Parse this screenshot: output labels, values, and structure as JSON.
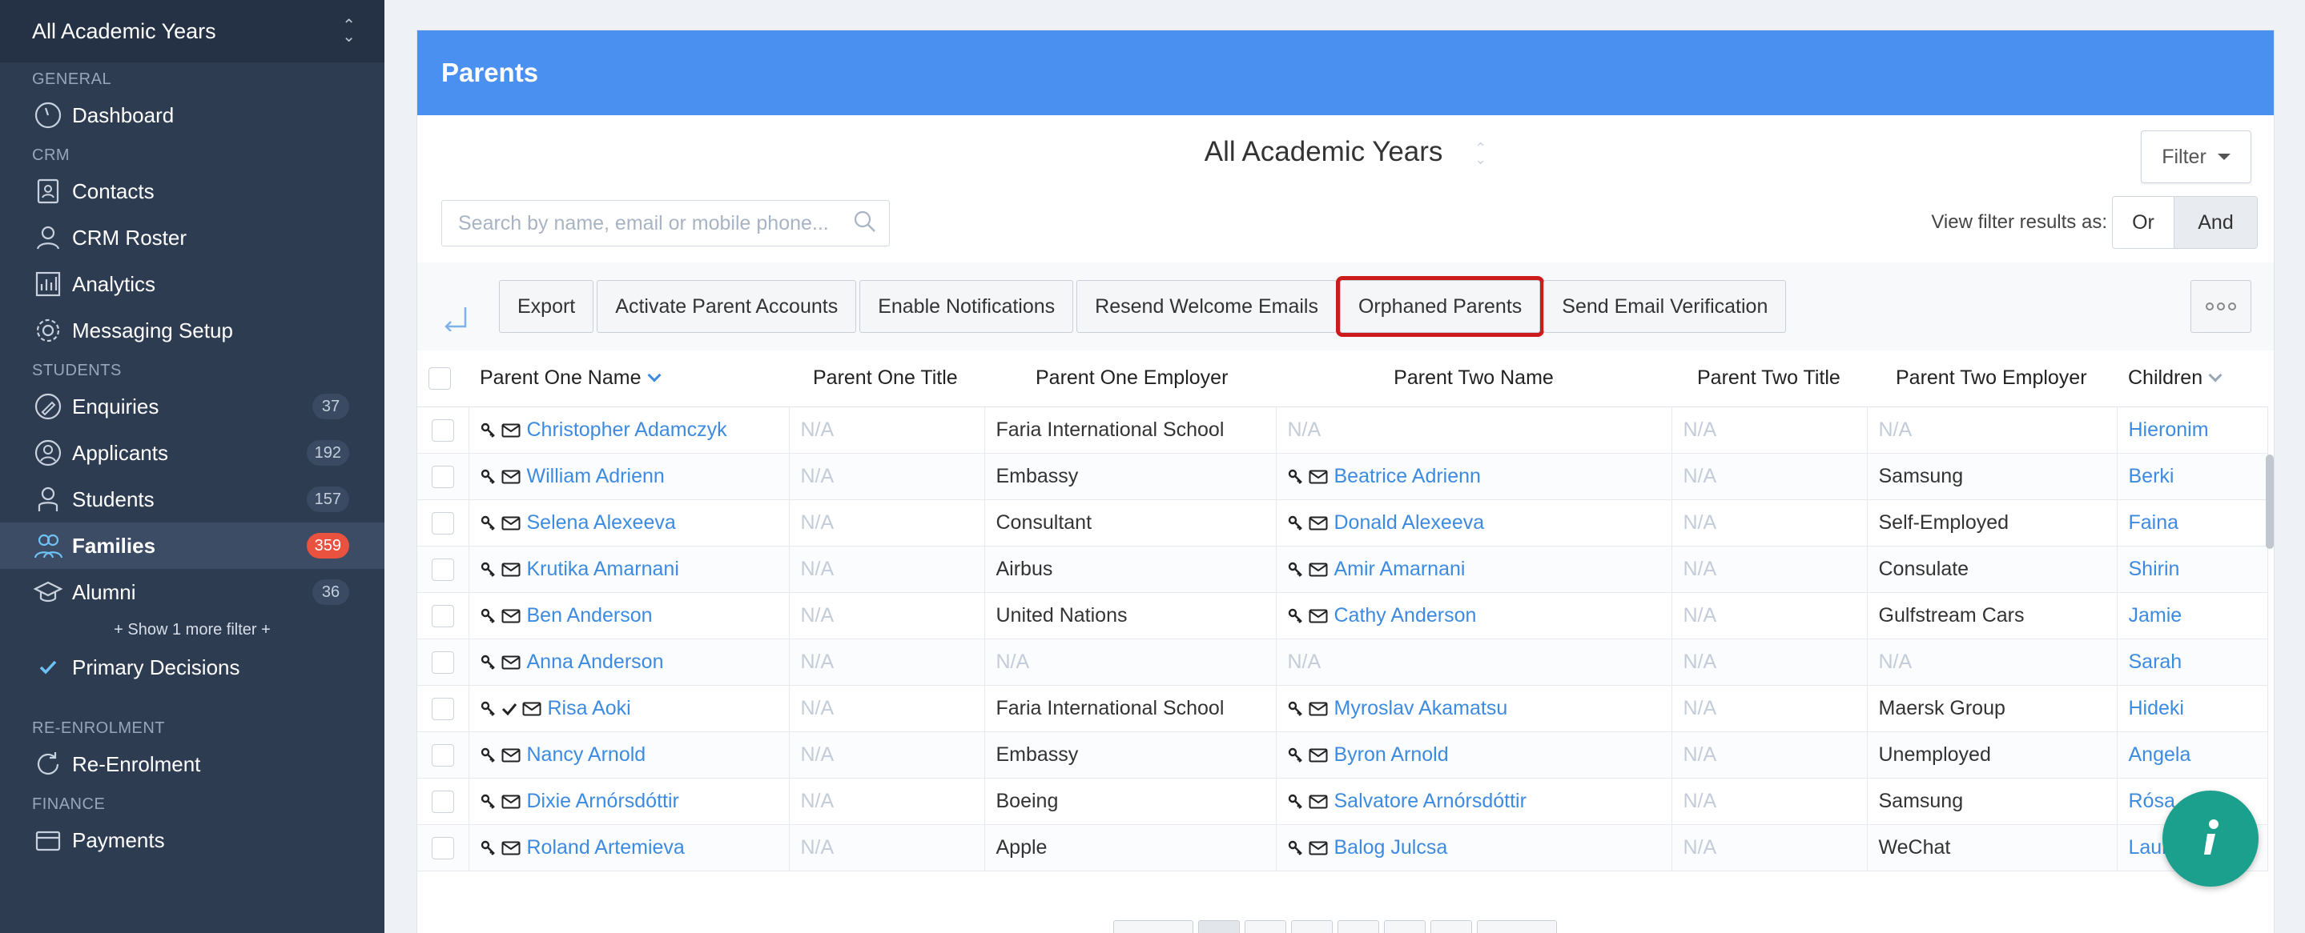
{
  "sidebar": {
    "year_select": "All Academic Years",
    "sections": {
      "general": "GENERAL",
      "crm": "CRM",
      "students": "STUDENTS",
      "reenrolment": "RE-ENROLMENT",
      "finance": "FINANCE"
    },
    "items": {
      "dashboard": "Dashboard",
      "contacts": "Contacts",
      "crm_roster": "CRM Roster",
      "analytics": "Analytics",
      "messaging_setup": "Messaging Setup",
      "enquiries": "Enquiries",
      "enquiries_count": "37",
      "applicants": "Applicants",
      "applicants_count": "192",
      "students": "Students",
      "students_count": "157",
      "families": "Families",
      "families_count": "359",
      "alumni": "Alumni",
      "alumni_count": "36",
      "show_more": "+ Show 1 more filter +",
      "primary_decisions": "Primary Decisions",
      "reenrolment": "Re-Enrolment",
      "payments": "Payments"
    }
  },
  "page": {
    "header": "Parents",
    "year_title": "All Academic Years",
    "filter_label": "Filter",
    "search_placeholder": "Search by name, email or mobile phone...",
    "view_filter_label": "View filter results as:",
    "view_or": "Or",
    "view_and": "And"
  },
  "toolbar": {
    "export": "Export",
    "activate": "Activate Parent Accounts",
    "enable_notifications": "Enable Notifications",
    "resend_welcome": "Resend Welcome Emails",
    "orphaned": "Orphaned Parents",
    "send_verification": "Send Email Verification"
  },
  "table": {
    "columns": [
      "Parent One Name",
      "Parent One Title",
      "Parent One Employer",
      "Parent Two Name",
      "Parent Two Title",
      "Parent Two Employer",
      "Children"
    ],
    "rows": [
      {
        "p1": "Christopher Adamczyk",
        "p1_title": "N/A",
        "p1_emp": "Faria International School",
        "p2": "N/A",
        "p2_title": "N/A",
        "p2_emp": "N/A",
        "child": "Hieronim"
      },
      {
        "p1": "William Adrienn",
        "p1_title": "N/A",
        "p1_emp": "Embassy",
        "p2": "Beatrice Adrienn",
        "p2_title": "N/A",
        "p2_emp": "Samsung",
        "child": "Berki"
      },
      {
        "p1": "Selena Alexeeva",
        "p1_title": "N/A",
        "p1_emp": "Consultant",
        "p2": "Donald Alexeeva",
        "p2_title": "N/A",
        "p2_emp": "Self-Employed",
        "child": "Faina"
      },
      {
        "p1": "Krutika Amarnani",
        "p1_title": "N/A",
        "p1_emp": "Airbus",
        "p2": "Amir Amarnani",
        "p2_title": "N/A",
        "p2_emp": "Consulate",
        "child": "Shirin"
      },
      {
        "p1": "Ben Anderson",
        "p1_title": "N/A",
        "p1_emp": "United Nations",
        "p2": "Cathy Anderson",
        "p2_title": "N/A",
        "p2_emp": "Gulfstream Cars",
        "child": "Jamie"
      },
      {
        "p1": "Anna Anderson",
        "p1_title": "N/A",
        "p1_emp": "N/A",
        "p2": "N/A",
        "p2_title": "N/A",
        "p2_emp": "N/A",
        "child": "Sarah"
      },
      {
        "p1": "Risa Aoki",
        "p1_title": "N/A",
        "p1_emp": "Faria International School",
        "p2": "Myroslav Akamatsu",
        "p2_title": "N/A",
        "p2_emp": "Maersk Group",
        "child": "Hideki"
      },
      {
        "p1": "Nancy Arnold",
        "p1_title": "N/A",
        "p1_emp": "Embassy",
        "p2": "Byron Arnold",
        "p2_title": "N/A",
        "p2_emp": "Unemployed",
        "child": "Angela"
      },
      {
        "p1": "Dixie Arnórsdóttir",
        "p1_title": "N/A",
        "p1_emp": "Boeing",
        "p2": "Salvatore Arnórsdóttir",
        "p2_title": "N/A",
        "p2_emp": "Samsung",
        "child": "Rósa"
      },
      {
        "p1": "Roland Artemieva",
        "p1_title": "N/A",
        "p1_emp": "Apple",
        "p2": "Balog Julcsa",
        "p2_title": "N/A",
        "p2_emp": "WeChat",
        "child": "Laura"
      }
    ]
  },
  "colors": {
    "sidebar_bg": "#2e3c52",
    "header_blue": "#4a90f0",
    "link_blue": "#3d8be0",
    "badge_red": "#e8523f",
    "highlight_red": "#cc1b1b",
    "fab_teal": "#1aa08c"
  }
}
